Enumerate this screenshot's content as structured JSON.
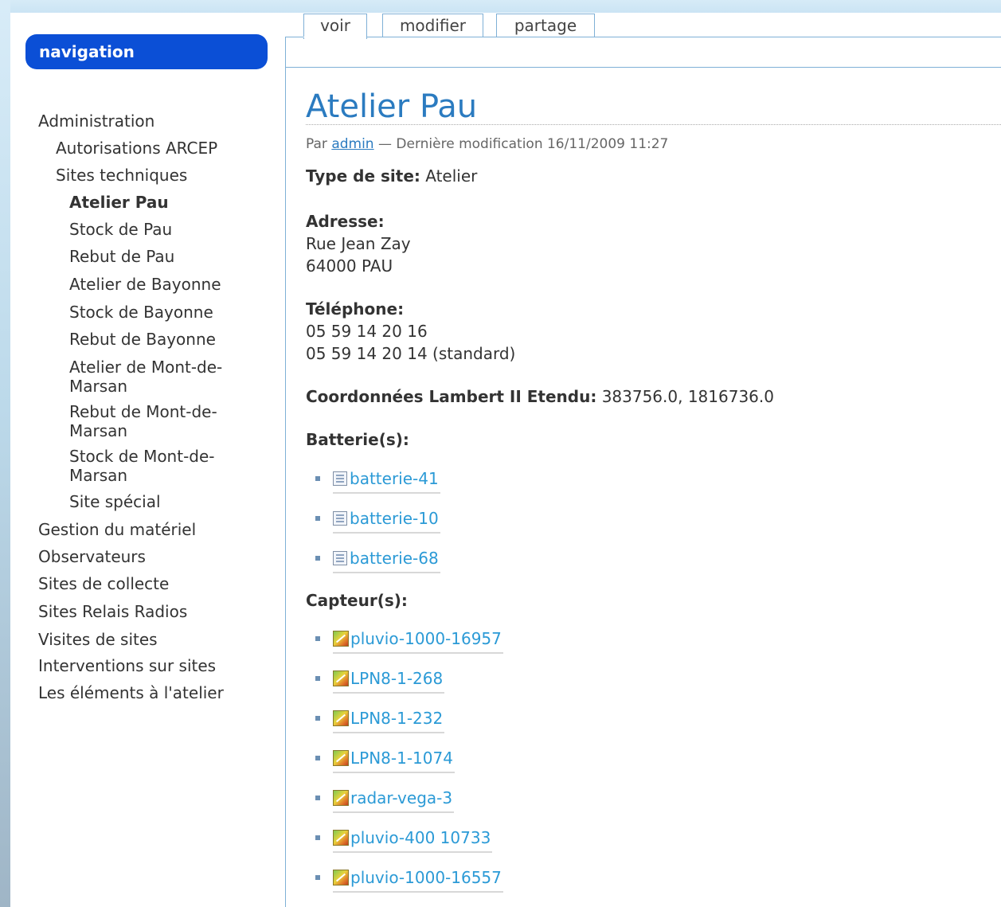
{
  "tabs": [
    {
      "label": "voir",
      "active": true
    },
    {
      "label": "modifier",
      "active": false
    },
    {
      "label": "partage",
      "active": false
    }
  ],
  "sidebar": {
    "header": "navigation",
    "items": [
      {
        "label": "Administration",
        "level": 0
      },
      {
        "label": "Autorisations ARCEP",
        "level": 1
      },
      {
        "label": "Sites techniques",
        "level": 1
      },
      {
        "label": "Atelier Pau",
        "level": 2,
        "current": true
      },
      {
        "label": "Stock de Pau",
        "level": 2
      },
      {
        "label": "Rebut de Pau",
        "level": 2
      },
      {
        "label": "Atelier de Bayonne",
        "level": 2
      },
      {
        "label": "Stock de Bayonne",
        "level": 2
      },
      {
        "label": "Rebut de Bayonne",
        "level": 2
      },
      {
        "label": "Atelier de Mont-de-Marsan",
        "level": 2
      },
      {
        "label": "Rebut de Mont-de-Marsan",
        "level": 2
      },
      {
        "label": "Stock de Mont-de-Marsan",
        "level": 2
      },
      {
        "label": "Site spécial",
        "level": 2
      },
      {
        "label": "Gestion du matériel",
        "level": 0
      },
      {
        "label": "Observateurs",
        "level": 0
      },
      {
        "label": "Sites de collecte",
        "level": 0
      },
      {
        "label": "Sites Relais Radios",
        "level": 0
      },
      {
        "label": "Visites de sites",
        "level": 0
      },
      {
        "label": "Interventions sur sites",
        "level": 0
      },
      {
        "label": "Les éléments à l'atelier",
        "level": 0
      }
    ]
  },
  "content": {
    "title": "Atelier Pau",
    "byline": {
      "prefix": "Par",
      "author": "admin",
      "suffix": "— Dernière modification 16/11/2009 11:27"
    },
    "type_label": "Type de site:",
    "type_value": "Atelier",
    "address_label": "Adresse:",
    "address_lines": [
      "Rue Jean Zay",
      "64000 PAU"
    ],
    "phone_label": "Téléphone:",
    "phone_lines": [
      "05 59 14 20 16",
      "05 59 14 20 14 (standard)"
    ],
    "coords_label": "Coordonnées Lambert II Etendu:",
    "coords_value": "383756.0, 1816736.0",
    "batteries_label": "Batterie(s):",
    "batteries": [
      "batterie-41",
      "batterie-10",
      "batterie-68"
    ],
    "sensors_label": "Capteur(s):",
    "sensors": [
      "pluvio-1000-16957",
      "LPN8-1-268",
      "LPN8-1-232",
      "LPN8-1-1074",
      "radar-vega-3",
      "pluvio-400 10733",
      "pluvio-1000-16557"
    ]
  },
  "icons": {
    "battery_item": "document-icon",
    "sensor_item": "sensor-icon"
  },
  "colors": {
    "nav_header": "#0b4fd6",
    "title": "#2b7bc0",
    "link": "#2b9ad6",
    "tab_border": "#7fb0d6"
  }
}
